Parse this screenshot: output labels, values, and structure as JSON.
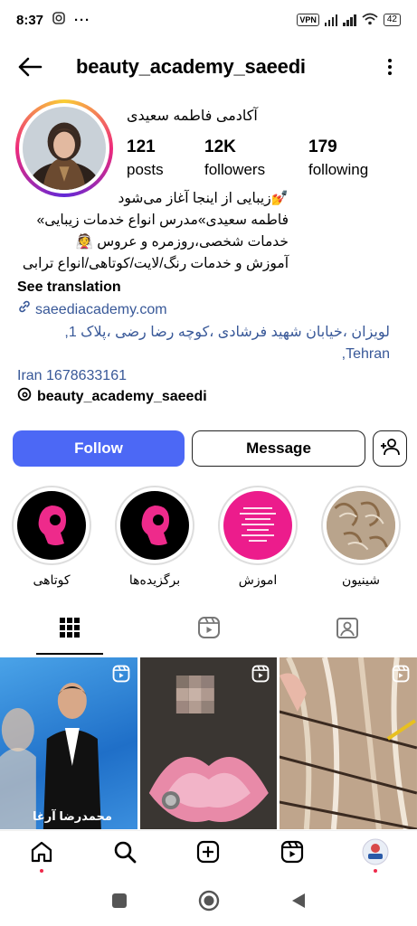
{
  "status_bar": {
    "time": "8:37",
    "vpn": "VPN",
    "battery": "42"
  },
  "header": {
    "username": "beauty_academy_saeedi"
  },
  "profile": {
    "full_name": "آکادمی فاطمه سعیدی",
    "stats": [
      {
        "value": "121",
        "label": "posts"
      },
      {
        "value": "12K",
        "label": "followers"
      },
      {
        "value": "179",
        "label": "following"
      }
    ],
    "bio_lines": [
      "💅زیبایی از اینجا آغاز می‌شود",
      "فاطمه سعیدی»مدرس انواع خدمات زیبایی»",
      "خدمات شخصی،روزمره و عروس 👰",
      "آموزش و خدمات رنگ/لایت/کوتاهی/انواع ترابی"
    ],
    "see_translation": "See translation",
    "link": "saeediacademy.com",
    "address_line1": "لویزان ،خیابان شهید فرشادی ،کوچه رضا رضی ،پلاک 1, Tehran,",
    "address_line2": "Iran 1678633161",
    "threads_handle": "beauty_academy_saeedi"
  },
  "actions": {
    "follow": "Follow",
    "message": "Message"
  },
  "highlights": [
    {
      "label": "کوتاهی",
      "kind": "silhouette"
    },
    {
      "label": "برگزیده‌ها",
      "kind": "silhouette"
    },
    {
      "label": "اموزش",
      "kind": "pink"
    },
    {
      "label": "شینیون",
      "kind": "hair"
    }
  ],
  "grid": [
    {
      "caption": "محمدرضا آرغا",
      "kind": "portrait"
    },
    {
      "caption": "",
      "kind": "cake"
    },
    {
      "caption": "",
      "kind": "hair"
    }
  ],
  "colors": {
    "follow_button": "#4c68f5",
    "link": "#385898",
    "notification_dot": "#ee2a4b"
  }
}
